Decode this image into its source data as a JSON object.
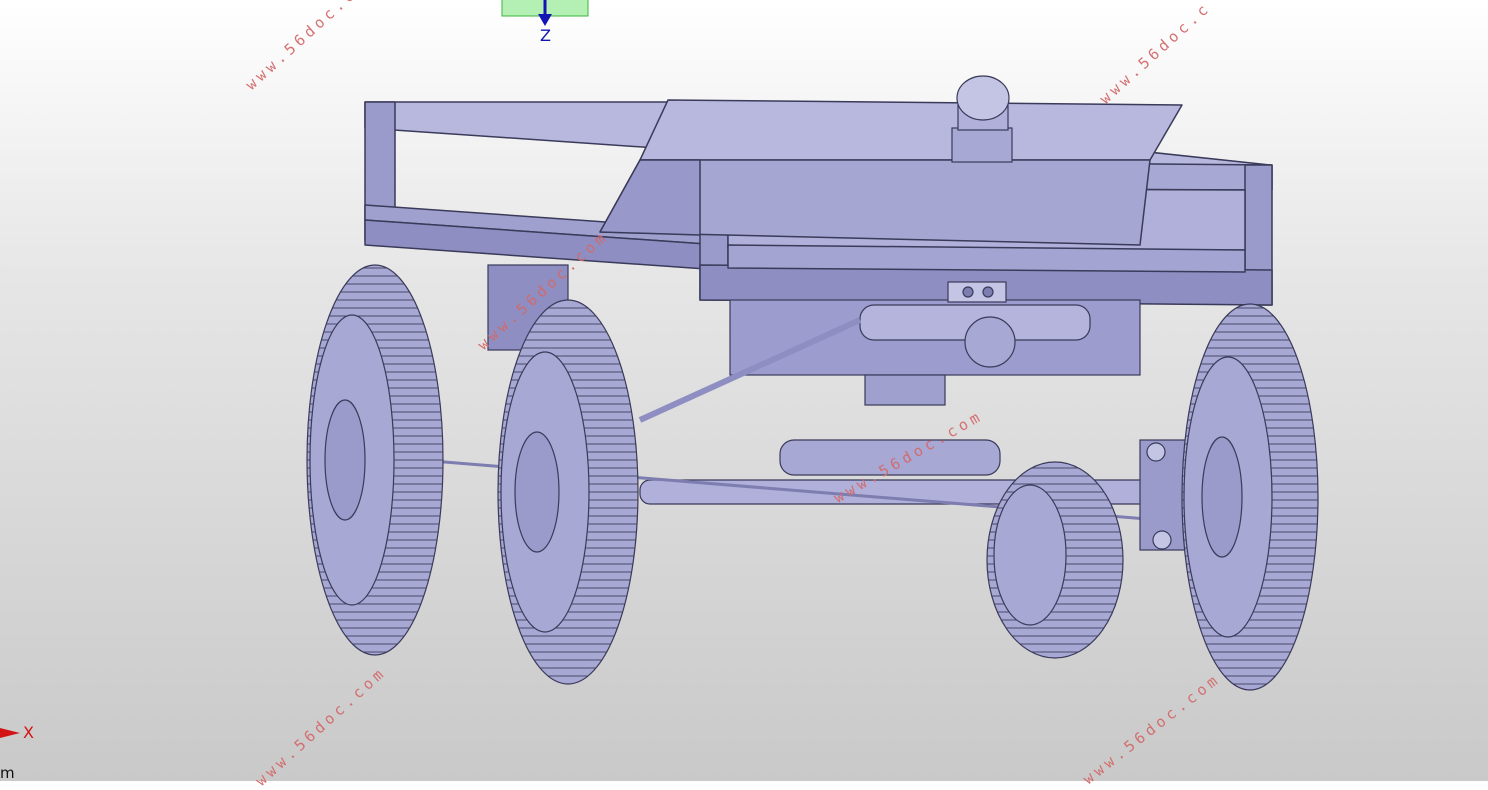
{
  "viewport": {
    "axis_z_label": "Z",
    "axis_x_label": "X",
    "unit_label": "m"
  },
  "watermarks": [
    "www.56doc.com",
    "www.56doc.c",
    "www.56doc.com",
    "www.56doc.com",
    "www.56doc.com",
    "www.56doc.com"
  ],
  "colors": {
    "model": "#a8a8d4",
    "model_dark": "#7d7db0",
    "model_light": "#c4c4e4",
    "edge": "#3a3a5a",
    "watermark": "#d36a6a",
    "axis_z": "#1414b4",
    "axis_x": "#d21414",
    "triad_box": "#b4f0b4"
  }
}
